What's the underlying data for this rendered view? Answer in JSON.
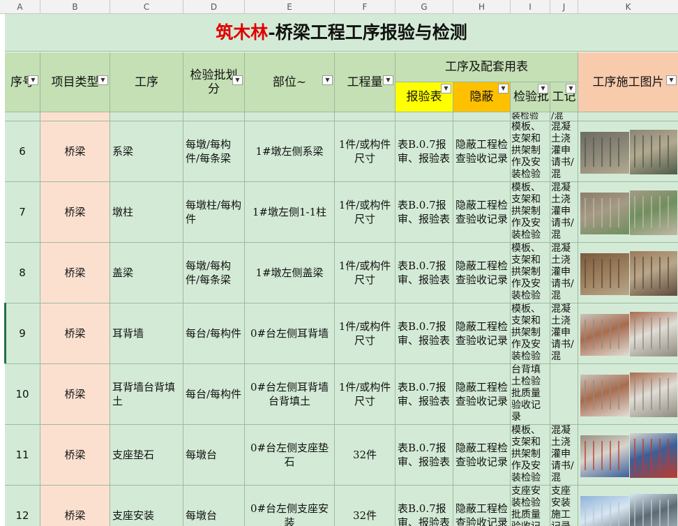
{
  "columns": [
    "A",
    "B",
    "C",
    "D",
    "E",
    "F",
    "G",
    "H",
    "I",
    "J",
    "K"
  ],
  "title": {
    "brand": "筑木林",
    "rest": "-桥梁工程工序报验与检测"
  },
  "headers": {
    "seq": "序号",
    "project_type": "项目类型",
    "process": "工序",
    "batch": "检验批划分",
    "location": "部位~",
    "quantity": "工程量",
    "forms_group": "工序及配套用表",
    "inspection_form": "报验表",
    "concealed": "隐蔽",
    "batch_check": "检验批",
    "work_record": "工记",
    "photos": "工序施工图片"
  },
  "partial_row": {
    "i_text": "装检验",
    "j_text": "/混"
  },
  "rows": [
    {
      "seq": "6",
      "type": "桥梁",
      "process": "系梁",
      "batch": "每墩/每构件/每条梁",
      "location": "1#墩左侧系梁",
      "quantity": "1件/或构件尺寸",
      "form": "表B.0.7报审、报验表",
      "concealed": "隐蔽工程检查验收记录",
      "batch_check": "模板、支架和拱架制作及安装检验",
      "record": "混凝土浇灌申请书/混"
    },
    {
      "seq": "7",
      "type": "桥梁",
      "process": "墩柱",
      "batch": "每墩柱/每构件",
      "location": "1#墩左侧1-1柱",
      "quantity": "1件/或构件尺寸",
      "form": "表B.0.7报审、报验表",
      "concealed": "隐蔽工程检查验收记录",
      "batch_check": "模板、支架和拱架制作及安装检验",
      "record": "混凝土浇灌申请书/混"
    },
    {
      "seq": "8",
      "type": "桥梁",
      "process": "盖梁",
      "batch": "每墩/每构件/每条梁",
      "location": "1#墩左侧盖梁",
      "quantity": "1件/或构件尺寸",
      "form": "表B.0.7报审、报验表",
      "concealed": "隐蔽工程检查验收记录",
      "batch_check": "模板、支架和拱架制作及安装检验",
      "record": "混凝土浇灌申请书/混"
    },
    {
      "seq": "9",
      "type": "桥梁",
      "process": "耳背墙",
      "batch": "每台/每构件",
      "location": "0#台左侧耳背墙",
      "quantity": "1件/或构件尺寸",
      "form": "表B.0.7报审、报验表",
      "concealed": "隐蔽工程检查验收记录",
      "batch_check": "模板、支架和拱架制作及安装检验",
      "record": "混凝土浇灌申请书/混"
    },
    {
      "seq": "10",
      "type": "桥梁",
      "process": "耳背墙台背填土",
      "batch": "每台/每构件",
      "location": "0#台左侧耳背墙台背填土",
      "quantity": "1件/或构件尺寸",
      "form": "表B.0.7报审、报验表",
      "concealed": "隐蔽工程检查验收记录",
      "batch_check": "台背填土检验批质量验收记录",
      "record": ""
    },
    {
      "seq": "11",
      "type": "桥梁",
      "process": "支座垫石",
      "batch": "每墩台",
      "location": "0#台左侧支座垫石",
      "quantity": "32件",
      "form": "表B.0.7报审、报验表",
      "concealed": "隐蔽工程检查验收记录",
      "batch_check": "模板、支架和拱架制作及安装检验",
      "record": "混凝土浇灌申请书/混"
    },
    {
      "seq": "12",
      "type": "桥梁",
      "process": "支座安装",
      "batch": "每墩台",
      "location": "0#台左侧支座安装",
      "quantity": "32件",
      "form": "表B.0.7报审、报验表",
      "concealed": "隐蔽工程检查验收记录",
      "batch_check": "支座安装检验批质量验收记录",
      "record": "支座安装施工记录"
    }
  ],
  "colors": {
    "title_brand": "#e00000",
    "header_green": "#c5e0b4",
    "header_yellow": "#ffff00",
    "header_orange": "#ffc000",
    "header_peach": "#f8cbad",
    "body_green": "#d3ebd6",
    "body_salmon": "#fbe0d0"
  }
}
